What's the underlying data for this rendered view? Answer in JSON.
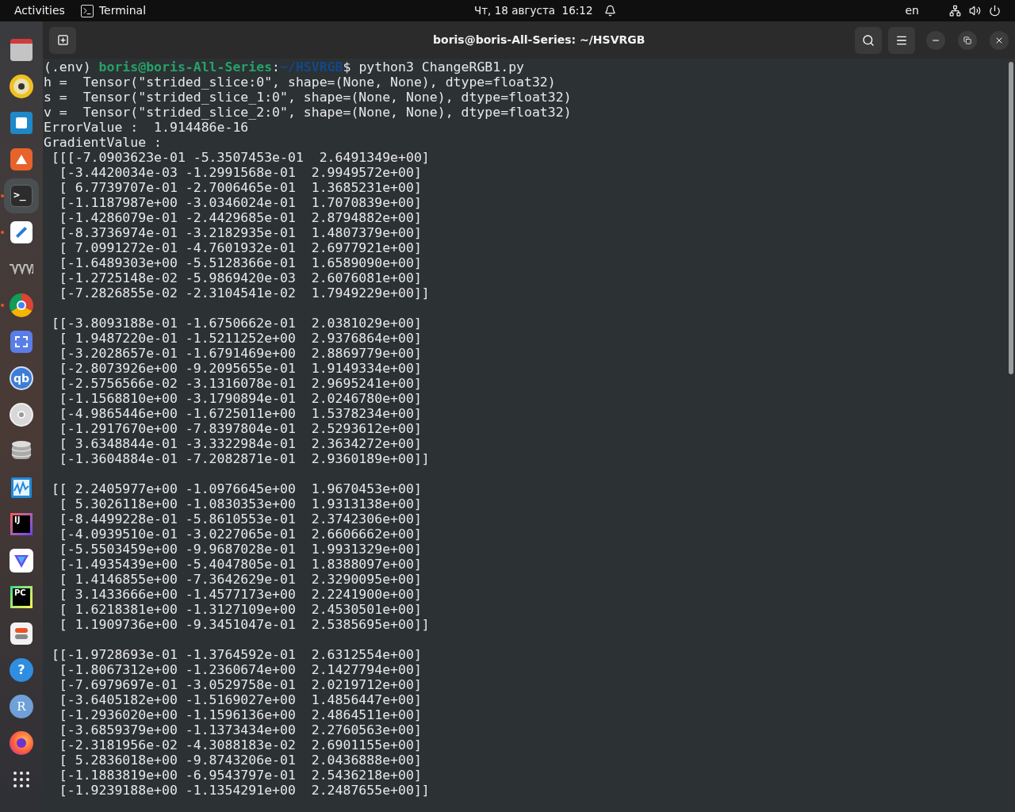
{
  "top_bar": {
    "activities": "Activities",
    "app": "Terminal",
    "clock": "Чт, 18 августа  16:12",
    "language": "en"
  },
  "dock": {
    "items": [
      {
        "kind": "files",
        "running": false,
        "selected": false
      },
      {
        "kind": "music",
        "running": false,
        "selected": false
      },
      {
        "kind": "writer",
        "running": false,
        "selected": false
      },
      {
        "kind": "store",
        "running": false,
        "selected": false
      },
      {
        "kind": "terminal",
        "glyph": ">_",
        "running": true,
        "selected": true
      },
      {
        "kind": "editor",
        "running": true,
        "selected": false
      },
      {
        "kind": "vm",
        "running": false,
        "selected": false
      },
      {
        "kind": "browser",
        "running": true,
        "selected": false
      },
      {
        "kind": "screenshot",
        "running": false,
        "selected": false
      },
      {
        "kind": "torrent",
        "glyph": "qb",
        "running": false,
        "selected": false
      },
      {
        "kind": "disc",
        "running": false,
        "selected": false
      },
      {
        "kind": "database",
        "running": false,
        "selected": false
      },
      {
        "kind": "monitor",
        "running": false,
        "selected": false
      },
      {
        "kind": "ide",
        "glyph": "IJ",
        "running": false,
        "selected": false
      },
      {
        "kind": "vpn",
        "running": false,
        "selected": false
      },
      {
        "kind": "ide2",
        "glyph": "PC",
        "running": false,
        "selected": false
      },
      {
        "kind": "tweaks",
        "running": false,
        "selected": false
      },
      {
        "kind": "help",
        "glyph": "?",
        "running": false,
        "selected": false
      },
      {
        "kind": "rlang",
        "glyph": "R",
        "running": false,
        "selected": false
      },
      {
        "kind": "firefox",
        "running": false,
        "selected": false
      },
      {
        "kind": "apps",
        "running": false,
        "selected": false
      }
    ]
  },
  "window": {
    "title": "boris@boris-All-Series: ~/HSVRGB"
  },
  "terminal": {
    "prompt": [
      {
        "kind": "plain",
        "text": "(.env) "
      },
      {
        "kind": "user",
        "text": "boris@boris-All-Series"
      },
      {
        "kind": "plain",
        "text": ":"
      },
      {
        "kind": "path",
        "text": "~/HSVRGB"
      },
      {
        "kind": "plain",
        "text": "$ python3 ChangeRGB1.py"
      }
    ],
    "output": [
      "h =  Tensor(\"strided_slice:0\", shape=(None, None), dtype=float32)",
      "s =  Tensor(\"strided_slice_1:0\", shape=(None, None), dtype=float32)",
      "v =  Tensor(\"strided_slice_2:0\", shape=(None, None), dtype=float32)",
      "ErrorValue :  1.914486e-16",
      "GradientValue :"
    ],
    "blocks": [
      [
        " [[[-7.0903623e-01 -5.3507453e-01  2.6491349e+00]",
        "  [-3.4420034e-03 -1.2991568e-01  2.9949572e+00]",
        "  [ 6.7739707e-01 -2.7006465e-01  1.3685231e+00]",
        "  [-1.1187987e+00 -3.0346024e-01  1.7070839e+00]",
        "  [-1.4286079e-01 -2.4429685e-01  2.8794882e+00]",
        "  [-8.3736974e-01 -3.2182935e-01  1.4807379e+00]",
        "  [ 7.0991272e-01 -4.7601932e-01  2.6977921e+00]",
        "  [-1.6489303e+00 -5.5128366e-01  1.6589090e+00]",
        "  [-1.2725148e-02 -5.9869420e-03  2.6076081e+00]",
        "  [-7.2826855e-02 -2.3104541e-02  1.7949229e+00]]"
      ],
      [
        " [[-3.8093188e-01 -1.6750662e-01  2.0381029e+00]",
        "  [ 1.9487220e-01 -1.5211252e+00  2.9376864e+00]",
        "  [-3.2028657e-01 -1.6791469e+00  2.8869779e+00]",
        "  [-2.8073926e+00 -9.2095655e-01  1.9149334e+00]",
        "  [-2.5756566e-02 -3.1316078e-01  2.9695241e+00]",
        "  [-1.1568810e+00 -3.1790894e-01  2.0246780e+00]",
        "  [-4.9865446e+00 -1.6725011e+00  1.5378234e+00]",
        "  [-1.2917670e+00 -7.8397804e-01  2.5293612e+00]",
        "  [ 3.6348844e-01 -3.3322984e-01  2.3634272e+00]",
        "  [-1.3604884e-01 -7.2082871e-01  2.9360189e+00]]"
      ],
      [
        " [[ 2.2405977e+00 -1.0976645e+00  1.9670453e+00]",
        "  [ 5.3026118e+00 -1.0830353e+00  1.9313138e+00]",
        "  [-8.4499228e-01 -5.8610553e-01  2.3742306e+00]",
        "  [-4.0939510e-01 -3.0227065e-01  2.6606662e+00]",
        "  [-5.5503459e+00 -9.9687028e-01  1.9931329e+00]",
        "  [-1.4935439e+00 -5.4047805e-01  1.8388097e+00]",
        "  [ 1.4146855e+00 -7.3642629e-01  2.3290095e+00]",
        "  [ 3.1433666e+00 -1.4577173e+00  2.2241900e+00]",
        "  [ 1.6218381e+00 -1.3127109e+00  2.4530501e+00]",
        "  [ 1.1909736e+00 -9.3451047e-01  2.5385695e+00]]"
      ],
      [
        " [[-1.9728693e-01 -1.3764592e-01  2.6312554e+00]",
        "  [-1.8067312e+00 -1.2360674e+00  2.1427794e+00]",
        "  [-7.6979697e-01 -3.0529758e-01  2.0219712e+00]",
        "  [-3.6405182e+00 -1.5169027e+00  1.4856447e+00]",
        "  [-1.2936020e+00 -1.1596136e+00  2.4864511e+00]",
        "  [-3.6859379e+00 -1.1373434e+00  2.2760563e+00]",
        "  [-2.3181956e-02 -4.3088183e-02  2.6901155e+00]",
        "  [ 5.2836018e+00 -9.8743206e-01  2.0436888e+00]",
        "  [-1.1883819e+00 -6.9543797e-01  2.5436218e+00]",
        "  [-1.9239188e+00 -1.1354291e+00  2.2487655e+00]]"
      ]
    ]
  }
}
